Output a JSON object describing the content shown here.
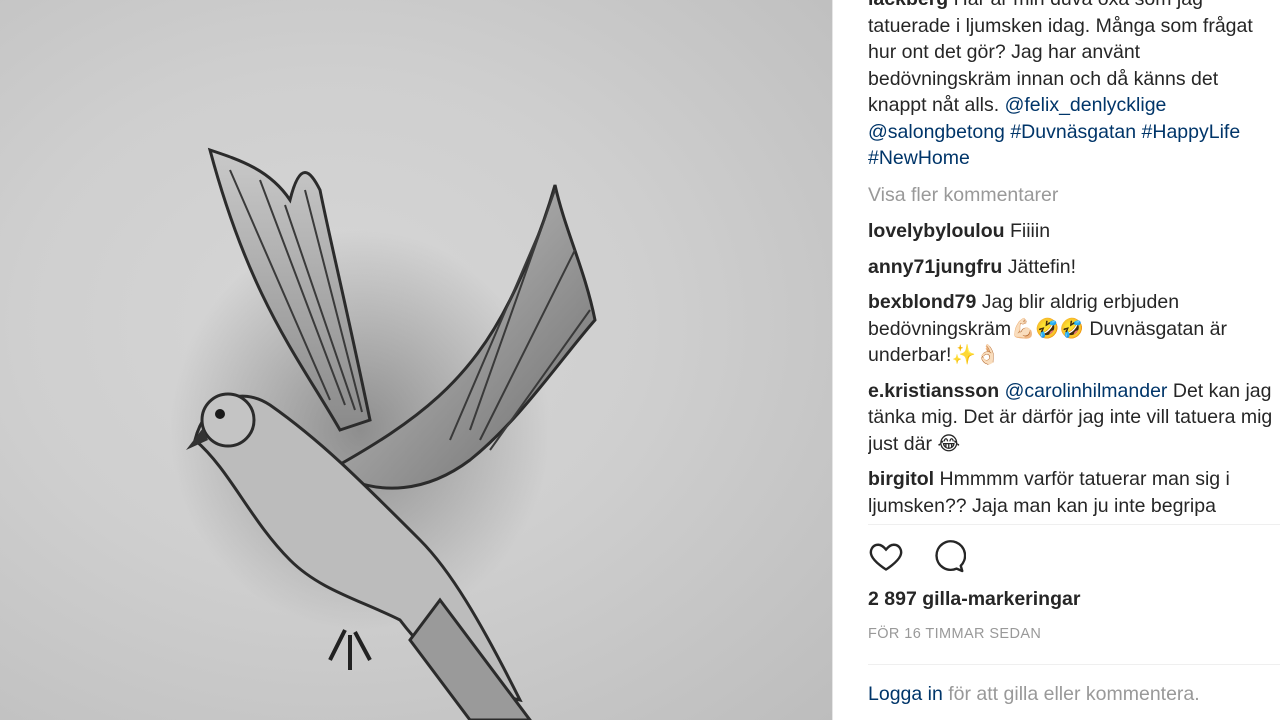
{
  "post": {
    "author": "lackberg",
    "caption_text": "Har är min duva oxå som jag tatuerade i ljumsken idag. Många som frågat hur ont det gör? Jag har använt bedövningskräm innan och då känns det knappt nåt alls.",
    "mentions": [
      "@felix_denlycklige",
      "@salongbetong"
    ],
    "hashtags": [
      "#Duvnäsgatan",
      "#HappyLife",
      "#NewHome"
    ]
  },
  "more_comments_label": "Visa fler kommentarer",
  "comments": [
    {
      "user": "lovelybyloulou",
      "text": "Fiiiin"
    },
    {
      "user": "anny71jungfru",
      "text": "Jättefin!"
    },
    {
      "user": "bexblond79",
      "text": "Jag blir aldrig erbjuden bedövningskräm💪🏻🤣🤣 Duvnäsgatan är underbar!✨👌🏻"
    },
    {
      "user": "e.kristiansson",
      "mention": "@carolinhilmander",
      "text": "Det kan jag tänka mig. Det är därför jag inte vill tatuera mig just där 😂"
    },
    {
      "user": "birgitol",
      "text": "Hmmmm varför tatuerar man sig i ljumsken?? Jaja man kan ju inte begripa"
    }
  ],
  "icons": {
    "like": "heart-icon",
    "comment": "comment-bubble-icon"
  },
  "likes_text": "2 897 gilla-markeringar",
  "timestamp": "FÖR 16 TIMMAR SEDAN",
  "login": {
    "link": "Logga in",
    "rest": " för att gilla eller kommentera."
  },
  "colors": {
    "link": "#003569",
    "muted": "#999999",
    "text": "#262626"
  }
}
